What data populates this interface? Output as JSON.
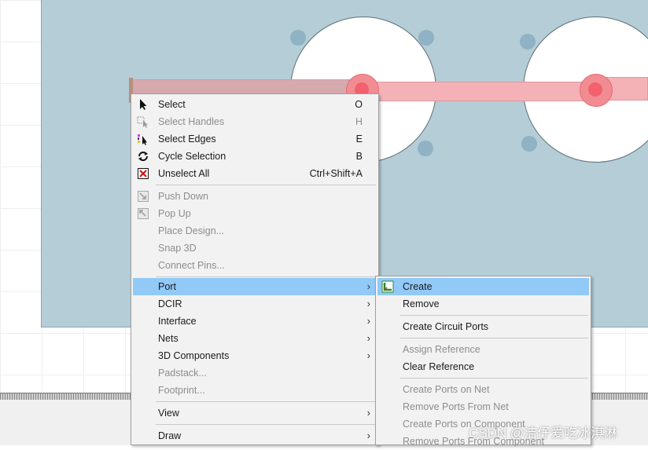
{
  "context_menu": {
    "items": [
      {
        "label": "Select",
        "shortcut": "O",
        "icon": "cursor-arrow-icon",
        "enabled": true
      },
      {
        "label": "Select Handles",
        "shortcut": "H",
        "icon": "select-handles-icon",
        "enabled": false
      },
      {
        "label": "Select Edges",
        "shortcut": "E",
        "icon": "select-edges-icon",
        "enabled": true
      },
      {
        "label": "Cycle Selection",
        "shortcut": "B",
        "icon": "cycle-icon",
        "enabled": true
      },
      {
        "label": "Unselect All",
        "shortcut": "Ctrl+Shift+A",
        "icon": "unselect-icon",
        "enabled": true
      },
      {
        "label": "Push Down",
        "icon": "push-down-icon",
        "enabled": false
      },
      {
        "label": "Pop Up",
        "icon": "pop-up-icon",
        "enabled": false
      },
      {
        "label": "Place Design...",
        "enabled": false
      },
      {
        "label": "Snap 3D",
        "enabled": false
      },
      {
        "label": "Connect Pins...",
        "enabled": false
      },
      {
        "label": "Port",
        "submenu": true,
        "highlighted": true
      },
      {
        "label": "DCIR",
        "submenu": true
      },
      {
        "label": "Interface",
        "submenu": true
      },
      {
        "label": "Nets",
        "submenu": true
      },
      {
        "label": "3D Components",
        "submenu": true
      },
      {
        "label": "Padstack...",
        "enabled": false
      },
      {
        "label": "Footprint...",
        "enabled": false
      },
      {
        "label": "View",
        "submenu": true
      },
      {
        "label": "Draw",
        "submenu": true
      }
    ]
  },
  "port_submenu": {
    "items": [
      {
        "label": "Create",
        "icon": "create-port-icon",
        "highlighted": true
      },
      {
        "label": "Remove"
      },
      {
        "label": "Create Circuit Ports"
      },
      {
        "label": "Assign Reference",
        "enabled": false
      },
      {
        "label": "Clear Reference"
      },
      {
        "label": "Create Ports on Net",
        "enabled": false
      },
      {
        "label": "Remove Ports From Net",
        "enabled": false
      },
      {
        "label": "Create Ports on Component",
        "enabled": false
      },
      {
        "label": "Remove Ports From Component",
        "enabled": false
      }
    ]
  },
  "watermark": "CSDN @洁仔爱吃冰淇淋",
  "colors": {
    "board": "#b4cdd6",
    "trace": "#f4b2b7",
    "menu_bg": "#f2f2f2",
    "menu_highlight": "#91c9f7",
    "disabled_text": "#8d8d8d"
  }
}
